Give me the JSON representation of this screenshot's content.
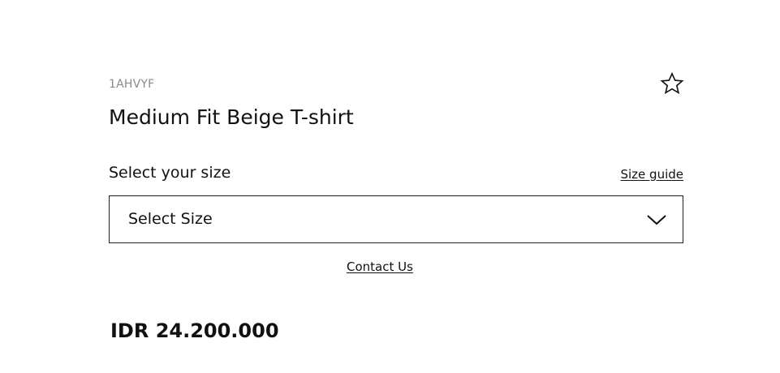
{
  "product": {
    "sku": "1AHVYF",
    "title": "Medium Fit Beige T-shirt",
    "price": "IDR 24.200.000",
    "favorite_icon": "star-outline-icon"
  },
  "size": {
    "label": "Select your size",
    "guide_link": "Size guide",
    "select_value": "Select Size",
    "select_icon": "chevron-down-icon"
  },
  "contact": {
    "link": "Contact Us"
  },
  "colors": {
    "text": "#111111",
    "muted": "#8a8a8a",
    "border": "#222222",
    "background": "#ffffff"
  }
}
